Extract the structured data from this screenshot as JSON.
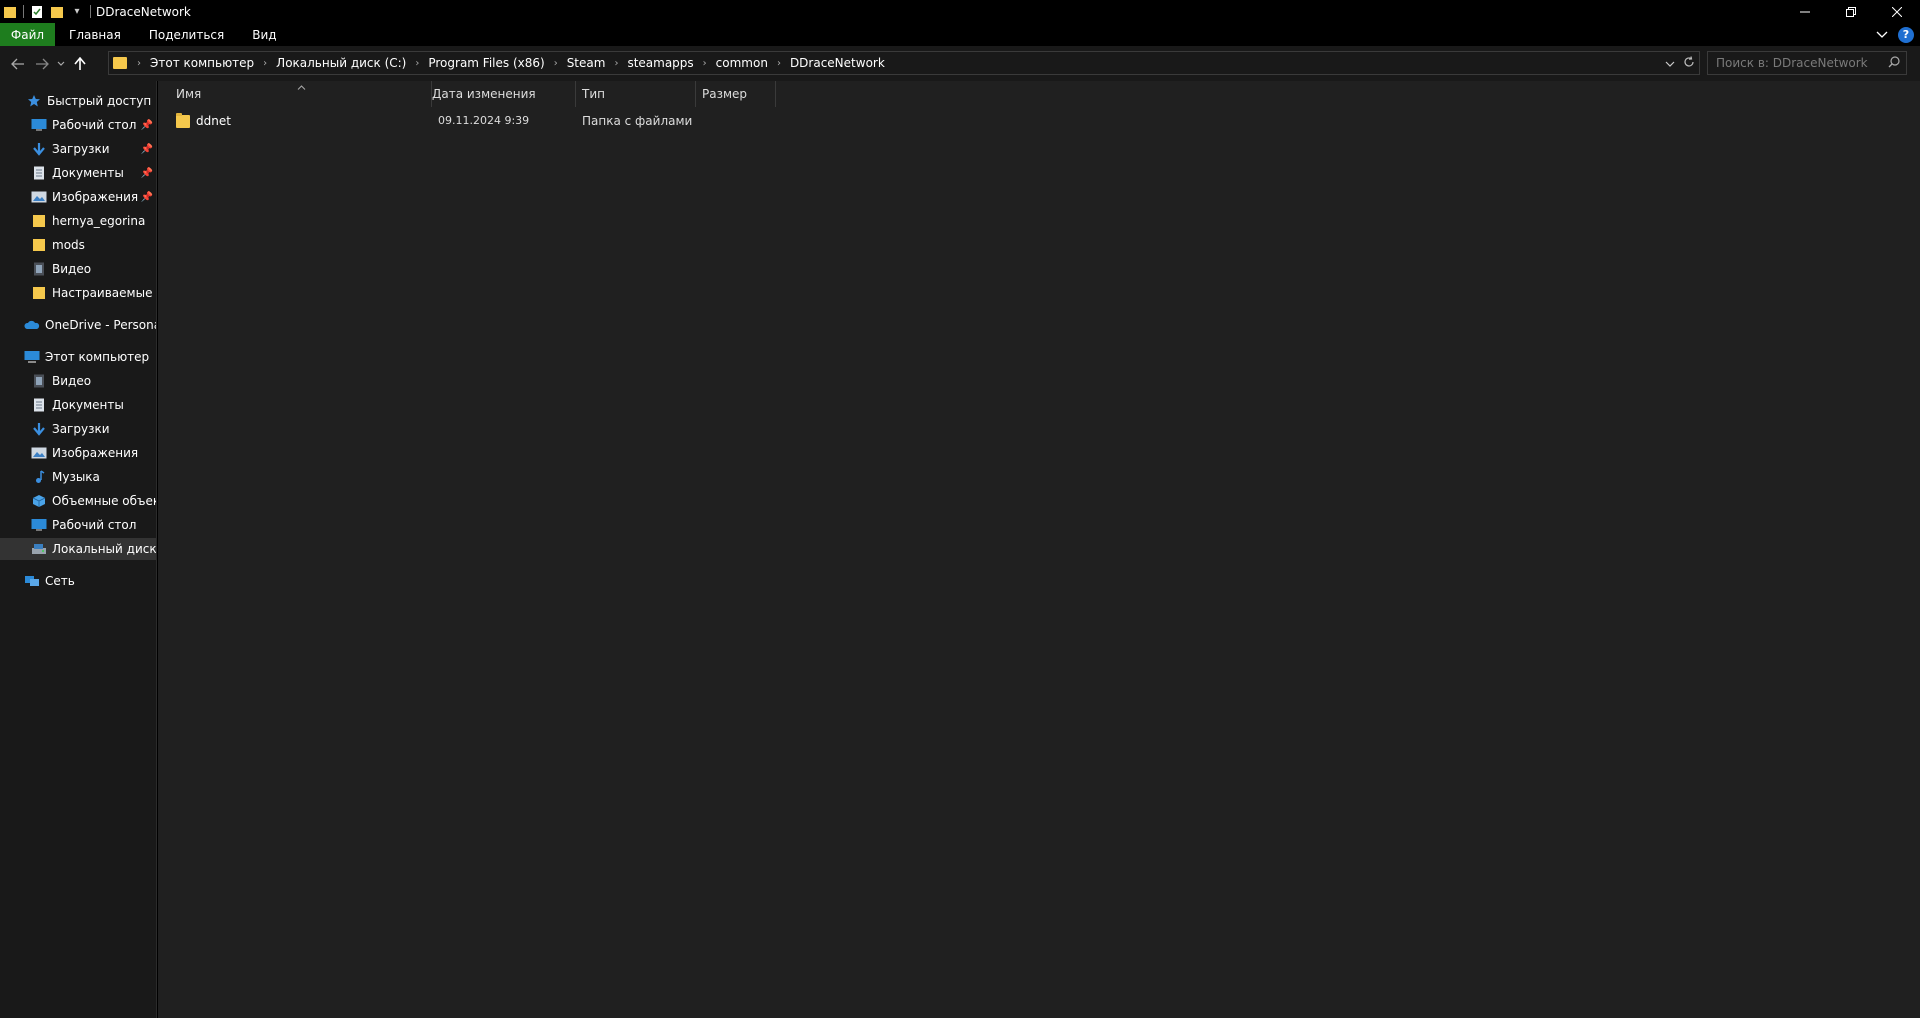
{
  "window": {
    "title": "DDraceNetwork",
    "qat_dropdown": "▾"
  },
  "ribbon": {
    "tabs": [
      {
        "label": "Файл"
      },
      {
        "label": "Главная"
      },
      {
        "label": "Поделиться"
      },
      {
        "label": "Вид"
      }
    ],
    "help": "?"
  },
  "address": {
    "crumbs": [
      "Этот компьютер",
      "Локальный диск (C:)",
      "Program Files (x86)",
      "Steam",
      "steamapps",
      "common",
      "DDraceNetwork"
    ]
  },
  "search": {
    "placeholder": "Поиск в: DDraceNetwork"
  },
  "sidebar": {
    "quick_access": {
      "label": "Быстрый доступ",
      "items": [
        {
          "label": "Рабочий стол",
          "icon": "desktop-icon",
          "pinned": true
        },
        {
          "label": "Загрузки",
          "icon": "downloads-icon",
          "pinned": true
        },
        {
          "label": "Документы",
          "icon": "documents-icon",
          "pinned": true
        },
        {
          "label": "Изображения",
          "icon": "pictures-icon",
          "pinned": true
        },
        {
          "label": "hernya_egorina",
          "icon": "folder-icon",
          "pinned": false
        },
        {
          "label": "mods",
          "icon": "folder-icon",
          "pinned": false
        },
        {
          "label": "Видео",
          "icon": "video-icon",
          "pinned": false
        },
        {
          "label": "Настраиваемые ш",
          "icon": "folder-icon",
          "pinned": false
        }
      ]
    },
    "onedrive": {
      "label": "OneDrive - Personal"
    },
    "this_pc": {
      "label": "Этот компьютер",
      "items": [
        {
          "label": "Видео"
        },
        {
          "label": "Документы"
        },
        {
          "label": "Загрузки"
        },
        {
          "label": "Изображения"
        },
        {
          "label": "Музыка"
        },
        {
          "label": "Объемные объекты"
        },
        {
          "label": "Рабочий стол"
        },
        {
          "label": "Локальный диск (C:)"
        }
      ]
    },
    "network": {
      "label": "Сеть"
    }
  },
  "columns": {
    "name": "Имя",
    "date": "Дата изменения",
    "type": "Тип",
    "size": "Размер"
  },
  "files": [
    {
      "name": "ddnet",
      "date": "09.11.2024 9:39",
      "type": "Папка с файлами",
      "size": ""
    }
  ]
}
